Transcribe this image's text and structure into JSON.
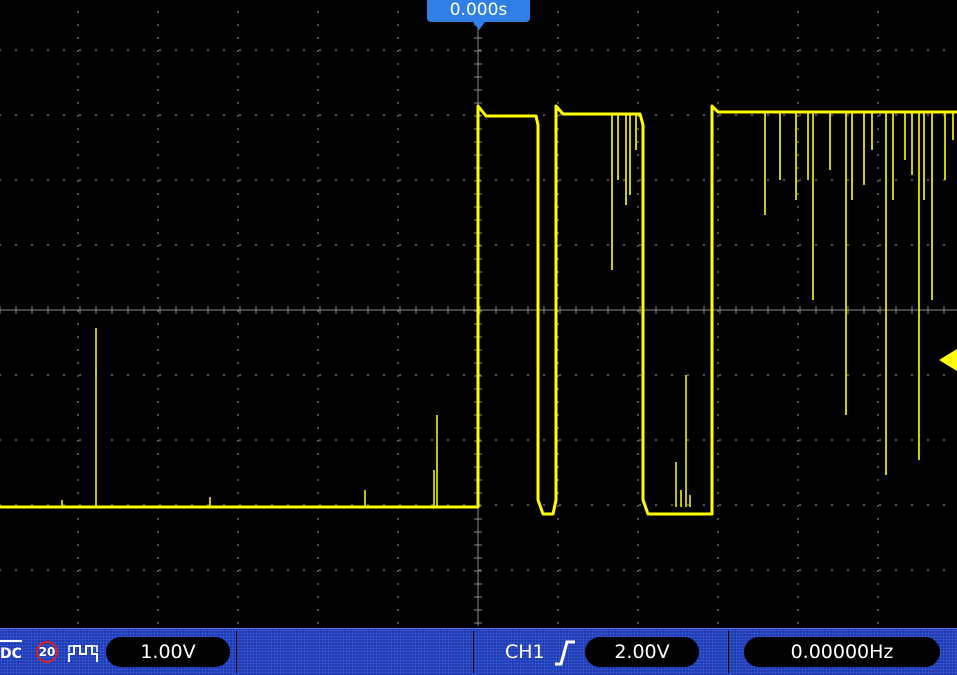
{
  "screen": {
    "time_offset": "0.000s",
    "trace_color": "#ffff00",
    "grid_color": "#8a8a8a"
  },
  "status_bar": {
    "coupling": "DC",
    "bandwidth_limit": "20",
    "channel_scale": "1.00V",
    "trigger_source": "CH1",
    "trigger_level": "2.00V",
    "frequency": "0.00000Hz"
  },
  "icons": {
    "bandwidth": "bw-limit-icon",
    "pulse": "pulse-icon",
    "trigger_edge": "rising-edge-icon",
    "time_marker": "time-marker-icon",
    "trigger_level": "trigger-level-marker-icon"
  }
}
